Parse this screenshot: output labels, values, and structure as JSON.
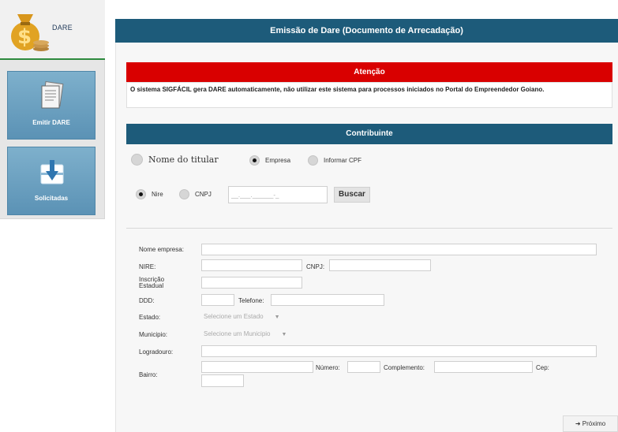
{
  "sidebar": {
    "brand_label": "DARE",
    "items": [
      {
        "label": "Emitir DARE",
        "icon": "documents-icon"
      },
      {
        "label": "Solicitadas",
        "icon": "download-box-icon"
      }
    ]
  },
  "header": {
    "title": "Emissão de Dare (Documento de Arrecadação)"
  },
  "alert": {
    "title": "Atenção",
    "message": "O sistema SIGFÁCIL gera DARE automaticamente, não utilizar este sistema para processos iniciados no Portal do Empreendedor Goiano."
  },
  "contribuinte": {
    "title": "Contribuinte",
    "tipo_options": [
      {
        "label": "Nome do titular",
        "selected": false
      },
      {
        "label": "Empresa",
        "selected": true
      },
      {
        "label": "Informar CPF",
        "selected": false
      }
    ],
    "ident_options": [
      {
        "label": "Nire",
        "selected": true
      },
      {
        "label": "CNPJ",
        "selected": false
      }
    ],
    "search_value": "__.___.______-_",
    "search_button": "Buscar"
  },
  "form": {
    "nome_empresa": "Nome empresa:",
    "nire": "NIRE:",
    "cnpj": "CNPJ:",
    "inscricao": "Inscrição Estadual",
    "ddd": "DDD:",
    "telefone": "Telefone:",
    "estado": "Estado:",
    "estado_placeholder": "Selecione um Estado",
    "municipio": "Municipio:",
    "municipio_placeholder": "Selecione um Municipio",
    "logradouro": "Logradouro:",
    "bairro": "Bairro:",
    "numero": "Número:",
    "complemento": "Complemento:",
    "cep": "Cep:"
  },
  "footer": {
    "next_label": "Próximo",
    "next_icon": "arrow-right-icon"
  },
  "colors": {
    "header": "#1d5b7a",
    "alert": "#d90000",
    "sidebar_button": "#6b9fc0"
  }
}
